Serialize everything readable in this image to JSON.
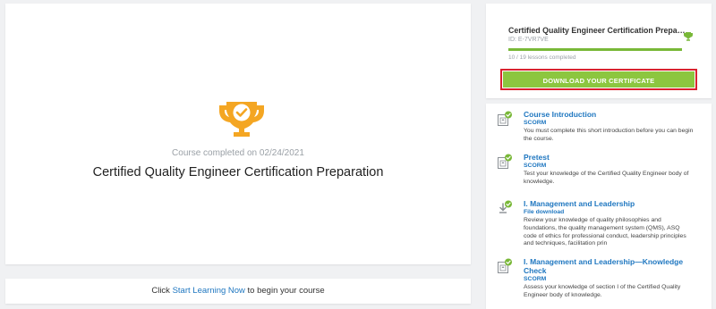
{
  "main": {
    "completed_text": "Course completed on 02/24/2021",
    "course_title": "Certified Quality Engineer Certification Preparation"
  },
  "start": {
    "prefix": "Click ",
    "link": "Start Learning Now",
    "suffix": " to begin your course"
  },
  "sidebar": {
    "title": "Certified Quality Engineer Certification Preparat...",
    "id": "ID: E-7VR7VE",
    "lessons_completed": "10 / 19 lessons completed",
    "progress_fraction": 1.0,
    "download_label": "DOWNLOAD YOUR CERTIFICATE",
    "lessons": [
      {
        "title": "Course Introduction",
        "type": "SCORM",
        "icon": "scorm-package-icon",
        "desc": "You must complete this short introduction before you can begin the course."
      },
      {
        "title": "Pretest",
        "type": "SCORM",
        "icon": "scorm-package-icon",
        "desc": "Test your knowledge of the Certified Quality Engineer body of knowledge."
      },
      {
        "title": "I. Management and Leadership",
        "type": "File download",
        "icon": "download-icon",
        "desc": "Review your knowledge of quality philosophies and foundations, the quality management system (QMS), ASQ code of ethics for professional conduct, leadership principles and techniques, facilitation prin"
      },
      {
        "title": "I. Management and Leadership—Knowledge Check",
        "type": "SCORM",
        "icon": "scorm-package-icon",
        "desc": "Assess your knowledge of section I of the Certified Quality Engineer body of knowledge."
      }
    ]
  },
  "colors": {
    "accent_green": "#8cc63f",
    "link_blue": "#1f77c0",
    "trophy_orange": "#f4a623",
    "highlight_red": "#d9222f"
  }
}
